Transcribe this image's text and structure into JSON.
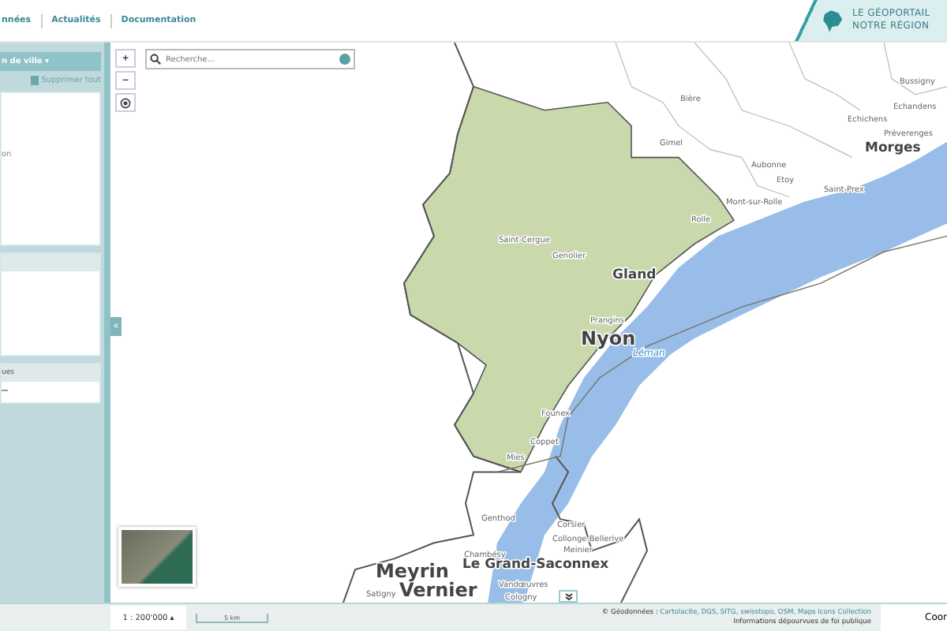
{
  "nav": {
    "links": [
      "nnées",
      "Actualités",
      "Documentation"
    ]
  },
  "logo": {
    "line1": "LE GÉOPORTAIL",
    "line2": "NOTRE RÉGION"
  },
  "sidebar": {
    "dropdown": "n de ville",
    "dropdown_caret": "▾",
    "clear_all": "Supprimer tout",
    "panels": [
      {
        "kind": "list",
        "text": "on"
      },
      {
        "kind": "strip"
      },
      {
        "kind": "small",
        "title": "ues"
      }
    ]
  },
  "map": {
    "controls": [
      "+",
      "−"
    ],
    "search": {
      "placeholder": "Recherche..."
    },
    "labels": [
      {
        "text": "Bussigny",
        "kind": "village"
      },
      {
        "text": "Bière",
        "kind": "village"
      },
      {
        "text": "Echandens",
        "kind": "village"
      },
      {
        "text": "Echichens",
        "kind": "village"
      },
      {
        "text": "Préverenges",
        "kind": "village"
      },
      {
        "text": "Gimel",
        "kind": "village"
      },
      {
        "text": "Morges",
        "kind": "town"
      },
      {
        "text": "Aubonne",
        "kind": "village"
      },
      {
        "text": "Etoy",
        "kind": "village"
      },
      {
        "text": "Saint-Prex",
        "kind": "village"
      },
      {
        "text": "Mont-sur-Rolle",
        "kind": "village"
      },
      {
        "text": "Rolle",
        "kind": "village"
      },
      {
        "text": "Saint-Cergue",
        "kind": "village"
      },
      {
        "text": "Genolier",
        "kind": "village"
      },
      {
        "text": "Gland",
        "kind": "town"
      },
      {
        "text": "Prangins",
        "kind": "village"
      },
      {
        "text": "Nyon",
        "kind": "city"
      },
      {
        "text": "Léman",
        "kind": "water"
      },
      {
        "text": "Founex",
        "kind": "village"
      },
      {
        "text": "Coppet",
        "kind": "village"
      },
      {
        "text": "Mies",
        "kind": "village"
      },
      {
        "text": "Genthod",
        "kind": "village"
      },
      {
        "text": "Corsier",
        "kind": "village"
      },
      {
        "text": "Collonge-Bellerive",
        "kind": "village"
      },
      {
        "text": "Meinier",
        "kind": "village"
      },
      {
        "text": "Chambésy",
        "kind": "village"
      },
      {
        "text": "Le Grand-Saconnex",
        "kind": "town"
      },
      {
        "text": "Meyrin",
        "kind": "city"
      },
      {
        "text": "Vandœuvres",
        "kind": "village"
      },
      {
        "text": "Satigny",
        "kind": "village"
      },
      {
        "text": "Cologny",
        "kind": "village"
      },
      {
        "text": "Vernier",
        "kind": "city"
      }
    ]
  },
  "collapse": {
    "icon": "«"
  },
  "footer": {
    "expanded": true,
    "scale": "1 : 200'000",
    "scale_caret": "▴",
    "scale_bar": "5 km",
    "attribution_prefix": "© Géodonnées :",
    "attribution_links": "Cartolacite, DGS, SITG, swisstopo, OSM, Maps Icons Collection",
    "disclaimer": "Informations dépourvues de foi publique",
    "coords": "Coor"
  }
}
